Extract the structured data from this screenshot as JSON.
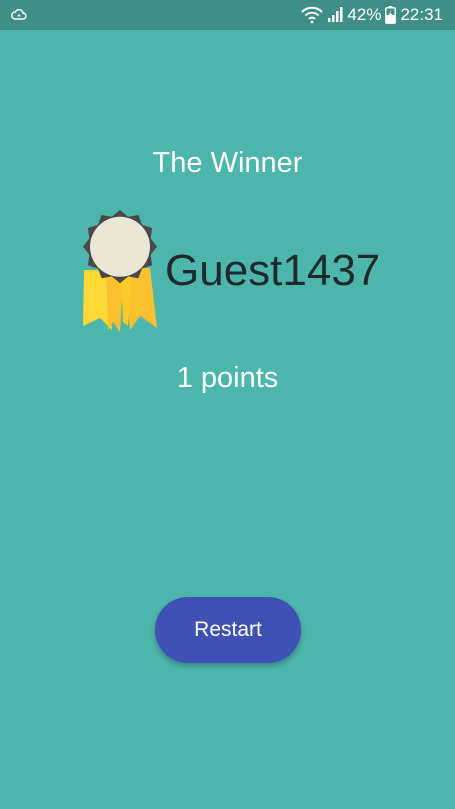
{
  "status_bar": {
    "left_icon": "cloud-sync-icon",
    "wifi_icon": "wifi-icon",
    "signal_icon": "signal-bars-icon",
    "battery_percent": "42%",
    "battery_icon": "battery-charging-icon",
    "time": "22:31"
  },
  "screen": {
    "title": "The Winner",
    "medal_icon": "award-ribbon-icon",
    "winner_name": "Guest1437",
    "points_text": "1 points",
    "restart_label": "Restart"
  },
  "colors": {
    "background": "#4db6ac",
    "status_bar": "#3f8f88",
    "button": "#3f51b5",
    "name_text": "#1f2a2a"
  }
}
